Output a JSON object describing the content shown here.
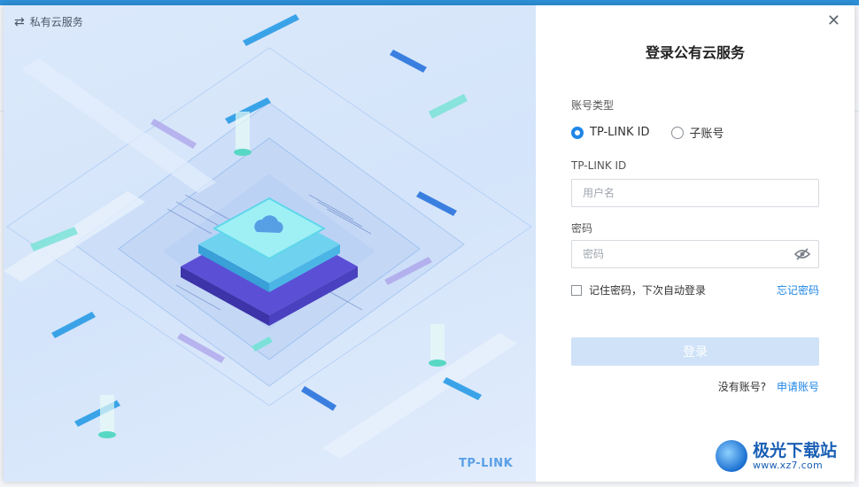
{
  "mode_switch": {
    "label": "私有云服务",
    "icon": "swap-arrows-icon"
  },
  "brand": {
    "mark": "TP-LINK"
  },
  "form": {
    "title": "登录公有云服务",
    "account_type_label": "账号类型",
    "account_types": [
      {
        "label": "TP-LINK ID",
        "selected": true
      },
      {
        "label": "子账号",
        "selected": false
      }
    ],
    "id_label": "TP-LINK ID",
    "username_placeholder": "用户名",
    "password_label": "密码",
    "password_placeholder": "密码",
    "remember_label": "记住密码，下次自动登录",
    "forgot_label": "忘记密码",
    "login_label": "登录",
    "no_account_text": "没有账号?",
    "signup_label": "申请账号"
  },
  "watermark": {
    "main": "极光下载站",
    "sub": "www.xz7.com"
  },
  "colors": {
    "accent": "#1f86e6",
    "login_disabled": "#cfe2f8",
    "art_bg": "#d4e4fa"
  }
}
